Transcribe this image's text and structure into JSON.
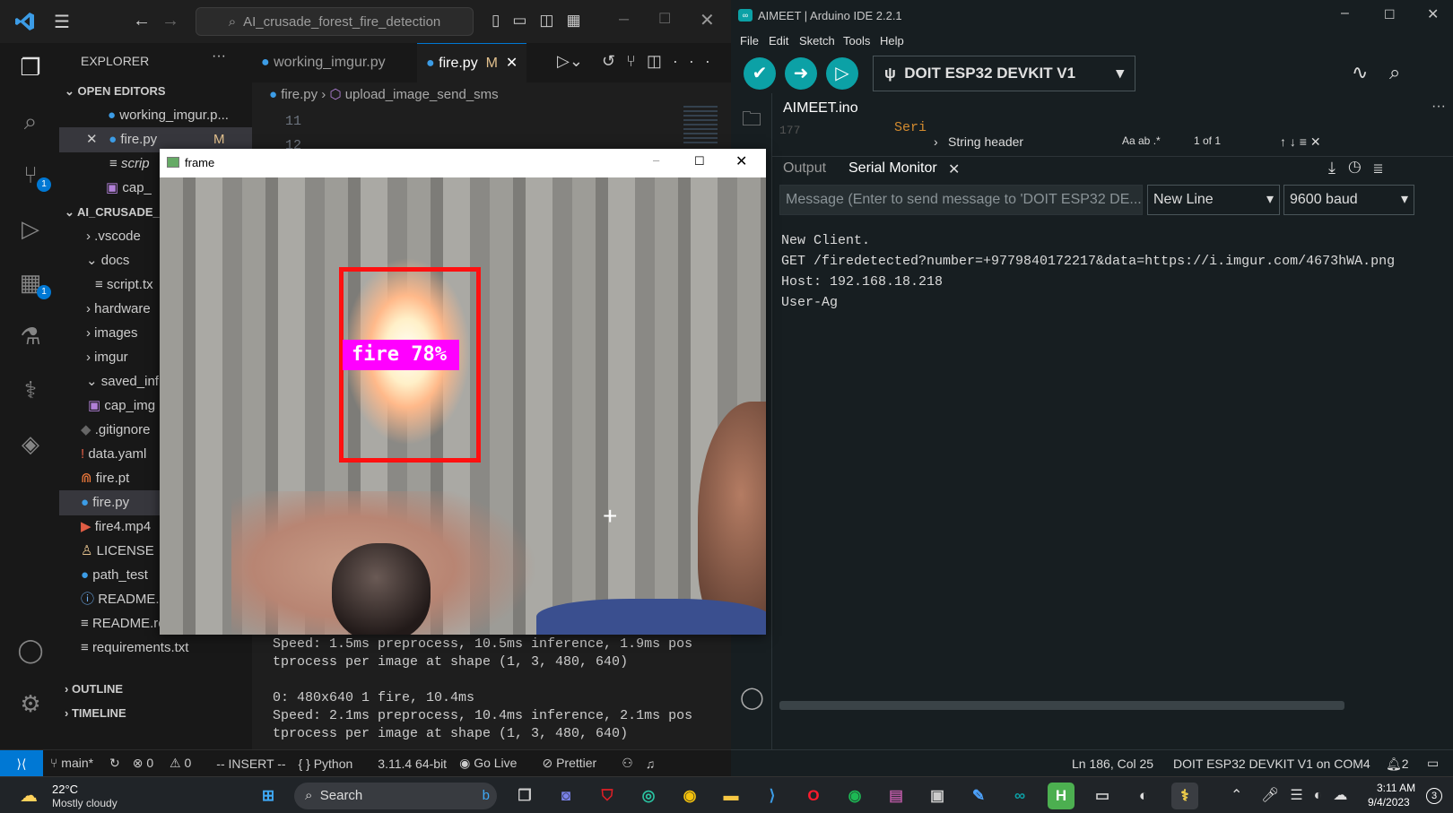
{
  "vscode": {
    "search": "AI_crusade_forest_fire_detection",
    "explorer_title": "EXPLORER",
    "tabs": [
      {
        "label": "working_imgur.py"
      },
      {
        "label": "fire.py",
        "modified": "M"
      }
    ],
    "breadcrumb": [
      "fire.py",
      "upload_image_send_sms"
    ],
    "open_editors_title": "OPEN EDITORS",
    "open_editors": [
      {
        "label": "working_imgur.p..."
      },
      {
        "label": "fire.py",
        "badge": "M"
      },
      {
        "label": "scrip"
      },
      {
        "label": "cap_"
      }
    ],
    "project_title": "AI_CRUSADE_",
    "tree": [
      ".vscode",
      "docs",
      "script.tx",
      "hardware",
      "images",
      "imgur",
      "saved_inf",
      "cap_img",
      ".gitignore",
      "data.yaml",
      "fire.pt",
      "fire.py",
      "fire4.mp4",
      "LICENSE",
      "path_test",
      "README.",
      "README.roboflow.txt",
      "requirements.txt"
    ],
    "outline": "OUTLINE",
    "timeline": "TIMELINE",
    "line_numbers": [
      "11",
      "12"
    ],
    "terminal_lines": [
      "Speed: 1.5ms preprocess, 10.5ms inference, 1.9ms pos",
      "tprocess per image at shape (1, 3, 480, 640)",
      "",
      "0: 480x640 1 fire, 10.4ms",
      "Speed: 2.1ms preprocess, 10.4ms inference, 2.1ms pos",
      "tprocess per image at shape (1, 3, 480, 640)"
    ],
    "status": {
      "branch": "main*",
      "errors": "0",
      "warnings": "0",
      "mode": "-- INSERT --",
      "language": "Python",
      "version": "3.11.4 64-bit",
      "golive": "Go Live",
      "prettier": "Prettier"
    },
    "badges": {
      "source_control": "1",
      "extensions": "1"
    }
  },
  "frame_window": {
    "title": "frame",
    "detection_label": "fire 78%",
    "detection_color": "#ff1010",
    "label_bg": "#ff00ff"
  },
  "arduino": {
    "title": "AIMEET | Arduino IDE 2.2.1",
    "menu": [
      "File",
      "Edit",
      "Sketch",
      "Tools",
      "Help"
    ],
    "board": "DOIT ESP32 DEVKIT V1",
    "file_tab": "AIMEET.ino",
    "find_text": "String header",
    "find_count": "1 of 1",
    "find_opts": "Aa  ab  .*",
    "code_frag": "Seri",
    "code_line": "177",
    "panel_tabs": [
      "Output",
      "Serial Monitor"
    ],
    "message_placeholder": "Message (Enter to send message to 'DOIT ESP32 DE...",
    "line_ending": "New Line",
    "baud": "9600 baud",
    "serial_lines": [
      "New Client.",
      "GET /firedetected?number=+9779840172217&data=https://i.imgur.com/4673hWA.png",
      "Host: 192.168.18.218",
      "User-Ag"
    ],
    "status": {
      "position": "Ln 186, Col 25",
      "board_port": "DOIT ESP32 DEVKIT V1 on COM4",
      "notifications": "2"
    }
  },
  "taskbar": {
    "temp": "22°C",
    "weather": "Mostly cloudy",
    "search": "Search",
    "time": "3:11 AM",
    "date": "9/4/2023",
    "notif": "3"
  },
  "colors": {
    "vscode_accent": "#0078d4",
    "arduino_teal": "#0ca1a6"
  }
}
